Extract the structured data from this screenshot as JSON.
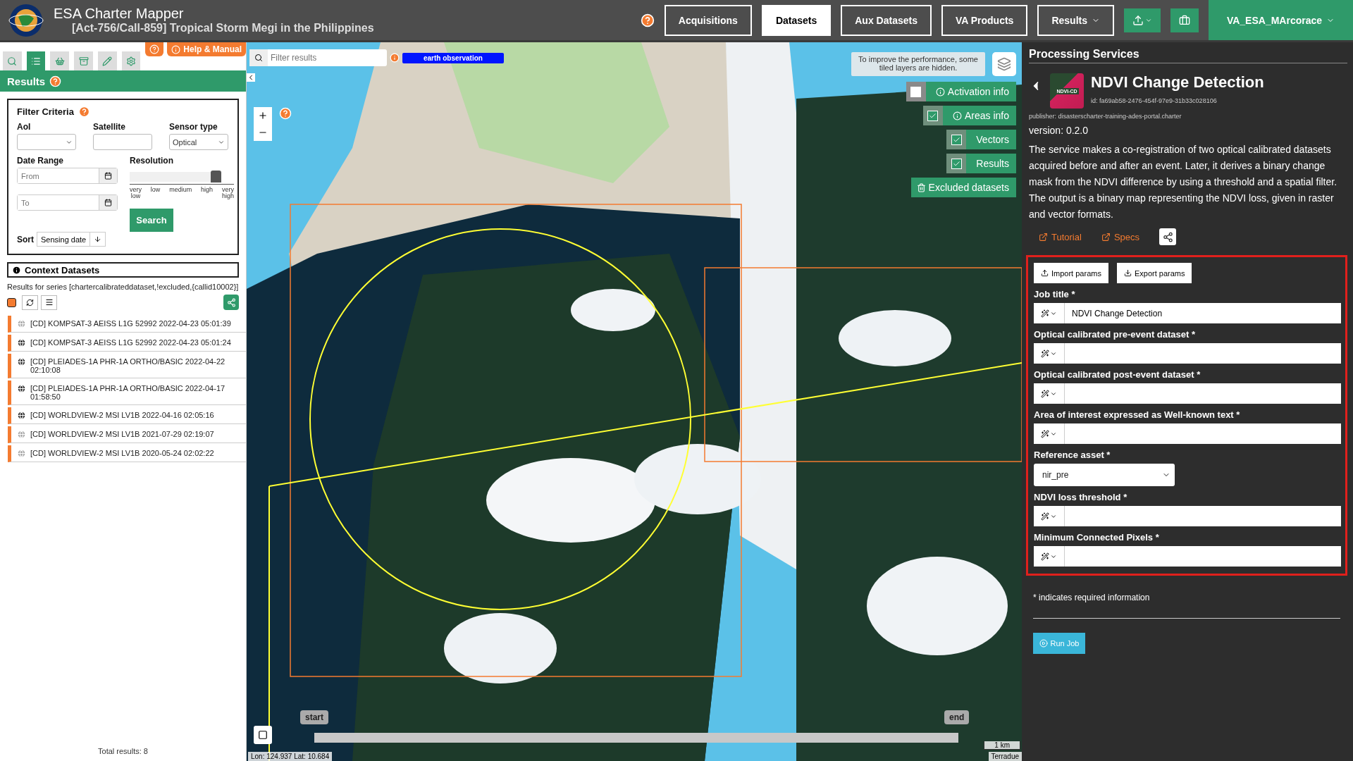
{
  "header": {
    "title": "ESA Charter Mapper",
    "subtitle": "[Act-756/Call-859] Tropical Storm Megi in the Philippines",
    "nav": [
      {
        "label": "Acquisitions",
        "selected": false,
        "kind": "button"
      },
      {
        "label": "Datasets",
        "selected": true,
        "kind": "button"
      },
      {
        "label": "Aux Datasets",
        "selected": false,
        "kind": "button"
      },
      {
        "label": "VA Products",
        "selected": false,
        "kind": "button"
      },
      {
        "label": "Results",
        "selected": false,
        "kind": "dropdown"
      }
    ],
    "user": "VA_ESA_MArcorace"
  },
  "left": {
    "tabs": [
      {
        "kind": "search",
        "selected": false
      },
      {
        "kind": "list",
        "selected": true
      },
      {
        "kind": "basket",
        "selected": false
      },
      {
        "kind": "archive",
        "selected": false
      },
      {
        "kind": "pencil",
        "selected": false
      },
      {
        "kind": "gear",
        "selected": false
      }
    ],
    "help_label": "Help & Manual",
    "panel_title": "Results",
    "filter": {
      "title": "Filter Criteria",
      "aoi_label": "AoI",
      "satellite_label": "Satellite",
      "sensor_label": "Sensor type",
      "sensor_value": "Optical",
      "date_label": "Date Range",
      "from_placeholder": "From",
      "to_placeholder": "To",
      "resolution_label": "Resolution",
      "resolution": {
        "level": 1.0,
        "ticks": [
          "very low",
          "low",
          "medium",
          "high",
          "very high"
        ]
      },
      "search_button": "Search",
      "sort_label": "Sort",
      "sort_value": "Sensing date"
    },
    "context": {
      "title": "Context Datasets",
      "series": "Results for series [chartercalibrateddataset,!excluded,{callid10002}]",
      "items": [
        {
          "label": "[CD] KOMPSAT-3 AEISS L1G 52992 2022-04-23 05:01:39",
          "active": false
        },
        {
          "label": "[CD] KOMPSAT-3 AEISS L1G 52992 2022-04-23 05:01:24",
          "active": true
        },
        {
          "label": "[CD] PLEIADES-1A PHR-1A ORTHO/BASIC 2022-04-22 02:10:08",
          "active": true
        },
        {
          "label": "[CD] PLEIADES-1A PHR-1A ORTHO/BASIC 2022-04-17 01:58:50",
          "active": true
        },
        {
          "label": "[CD] WORLDVIEW-2 MSI LV1B 2022-04-16 02:05:16",
          "active": true
        },
        {
          "label": "[CD] WORLDVIEW-2 MSI LV1B 2021-07-29 02:19:07",
          "active": false
        },
        {
          "label": "[CD] WORLDVIEW-2 MSI LV1B 2020-05-24 02:02:22",
          "active": false
        }
      ],
      "total": "Total results: 8"
    }
  },
  "map": {
    "filter_placeholder": "Filter results",
    "badge": "earth observation",
    "notice": "To improve the performance, some tiled layers are hidden.",
    "layers": [
      {
        "label": "Activation info",
        "checked": false,
        "kind": "toggle"
      },
      {
        "label": "Areas info",
        "checked": true,
        "kind": "toggle"
      },
      {
        "label": "Vectors",
        "checked": true,
        "kind": "toggle"
      },
      {
        "label": "Results",
        "checked": true,
        "kind": "toggle"
      },
      {
        "label": "Excluded datasets",
        "kind": "button"
      }
    ],
    "timeline_start": "start",
    "timeline_end": "end",
    "coordinates": "Lon: 124.937 Lat: 10.684",
    "scale": "1 km",
    "attribution": "Terradue"
  },
  "right": {
    "heading": "Processing Services",
    "service_title": "NDVI Change Detection",
    "logo_text": "NDVI-CD",
    "id": "id: fa69ab58-2476-454f-97e9-31b33c028106",
    "publisher": "publisher: disasterscharter-training-ades-portal.charter",
    "version": "version: 0.2.0",
    "description": "The service makes a co-registration of two optical calibrated datasets acquired before and after an event. Later, it derives a binary change mask from the NDVI difference by using a threshold and a spatial filter. The output is a binary map representing the NDVI loss, given in raster and vector formats.",
    "links": [
      "Tutorial",
      "Specs"
    ],
    "import_button": "Import params",
    "export_button": "Export params",
    "fields": [
      {
        "label": "Job title *",
        "kind": "input",
        "value": "NDVI Change Detection"
      },
      {
        "label": "Optical calibrated pre-event dataset *",
        "kind": "input"
      },
      {
        "label": "Optical calibrated post-event dataset *",
        "kind": "input"
      },
      {
        "label": "Area of interest expressed as Well-known text *",
        "kind": "input"
      },
      {
        "label": "Reference asset *",
        "kind": "select",
        "value": "nir_pre"
      },
      {
        "label": "NDVI loss threshold *",
        "kind": "input"
      },
      {
        "label": "Minimum Connected Pixels *",
        "kind": "input"
      }
    ],
    "required_note": "* indicates required information",
    "run_button": "Run Job"
  }
}
